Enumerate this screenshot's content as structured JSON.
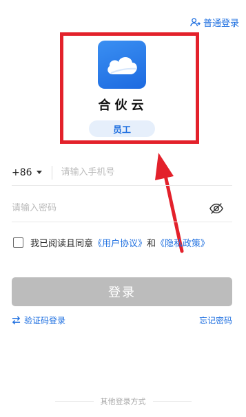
{
  "header": {
    "normal_login_label": "普通登录"
  },
  "app": {
    "name": "合伙云",
    "role_badge": "员工",
    "accent_color": "#1e6fe0"
  },
  "form": {
    "country_code": "+86",
    "phone_placeholder": "请输入手机号",
    "password_placeholder": "请输入密码",
    "agreement_prefix": "我已阅读且同意",
    "user_agreement_link": "《用户协议》",
    "and_text": "和",
    "privacy_policy_link": "《隐私政策》",
    "login_button": "登录",
    "sms_login_link": "验证码登录",
    "forgot_password_link": "忘记密码"
  },
  "footer": {
    "other_methods_label": "其他登录方式"
  },
  "annotation": {
    "highlight_color": "#e3212b"
  }
}
